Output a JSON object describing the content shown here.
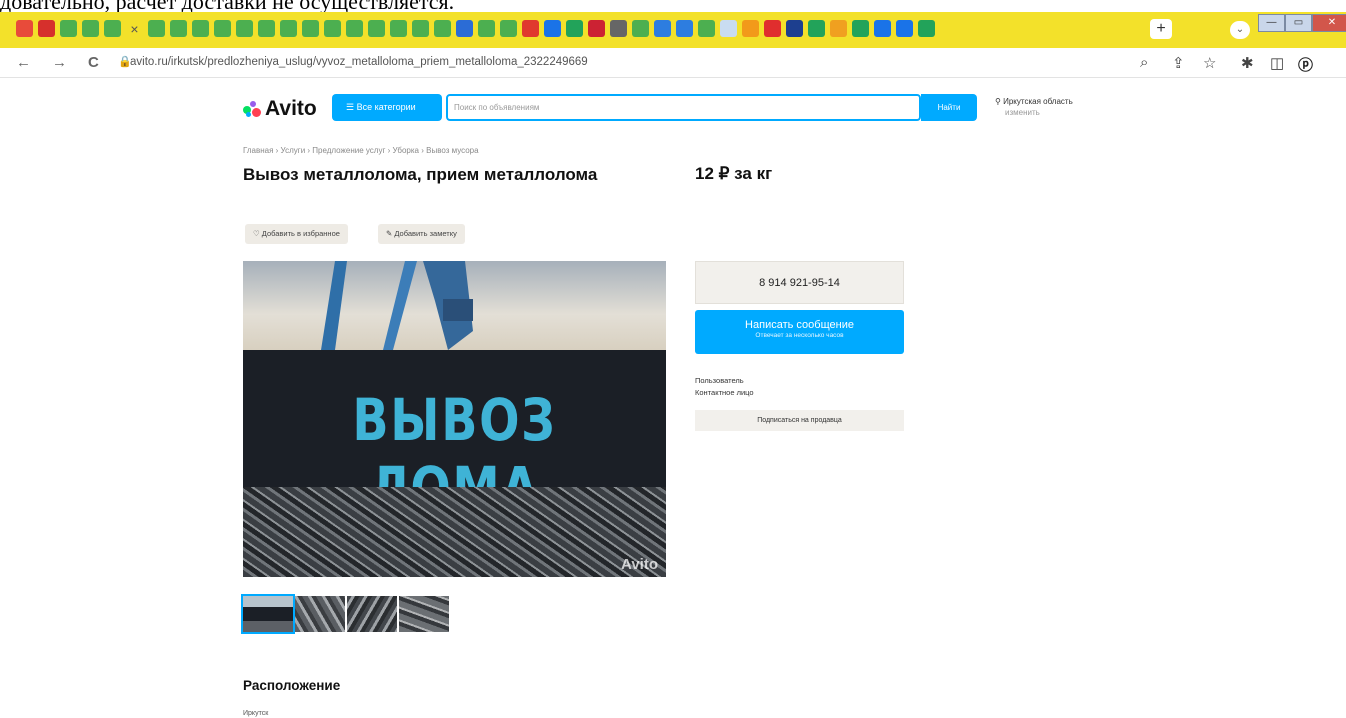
{
  "caption": "довательно, расчет доставки не осуществляется.",
  "tabs": {
    "close_glyph": "×",
    "new_tab": "+",
    "dropdown": "⌄",
    "icons": [
      "#e84b3a",
      "#d6302c",
      "#4caf50",
      "#4caf50",
      "#4caf50",
      "close",
      "#4caf50",
      "#4caf50",
      "#4caf50",
      "#4caf50",
      "#4caf50",
      "#4caf50",
      "#4caf50",
      "#4caf50",
      "#4caf50",
      "#4caf50",
      "#4caf50",
      "#4caf50",
      "#4caf50",
      "#4caf50",
      "#2b6cd6",
      "#4caf50",
      "#4caf50",
      "#e0392e",
      "#1a73e8",
      "#22a35a",
      "#cc2233",
      "#666666",
      "#4caf50",
      "#2d7de0",
      "#2d7de0",
      "#4caf50",
      "#c9dcf1",
      "#f29a1a",
      "#e02e2e",
      "#1d3f8f",
      "#22a35a",
      "#f0a020",
      "#22a35a",
      "#1a73e8",
      "#1a73e8",
      "#22a35a"
    ]
  },
  "window": {
    "minimize": "—",
    "maximize": "▭",
    "close": "✕"
  },
  "address": {
    "back": "←",
    "forward": "→",
    "reload": "C",
    "lock": "🔒",
    "url": "avito.ru/irkutsk/predlozheniya_uslug/vyvoz_metalloloma_priem_metalloloma_2322249669"
  },
  "header": {
    "logo": "Avito",
    "all_categories": "☰ Все категории",
    "search_placeholder": "Поиск по объявлениям",
    "search_button": "Найти",
    "region": "Иркутская область",
    "region_sub": "изменить"
  },
  "breadcrumbs": "Главная › Услуги › Предложение услуг › Уборка › Вывоз мусора",
  "listing": {
    "title": "Вывоз металлолома, прием металлолома",
    "price": "12 ₽ за кг",
    "favorite": "♡ Добавить в избранное",
    "note": "✎ Добавить заметку",
    "photo_text": "ВЫВОЗ ЛОМА",
    "watermark": "Avito"
  },
  "contact": {
    "phone": "8 914 921-95-14",
    "message_button": "Написать сообщение",
    "message_sub": "Отвечает за несколько часов",
    "seller_type": "Пользователь",
    "contact_person": "Контактное лицо",
    "subscribe": "Подписаться на продавца"
  },
  "location": {
    "heading": "Расположение",
    "city": "Иркутск"
  }
}
